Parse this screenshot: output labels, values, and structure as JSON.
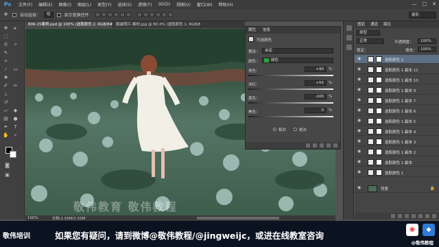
{
  "app": {
    "logo": "Ps"
  },
  "menu": [
    "文件(F)",
    "编辑(E)",
    "图像(I)",
    "图层(L)",
    "类型(Y)",
    "选择(S)",
    "滤镜(T)",
    "3D(D)",
    "视图(V)",
    "窗口(W)",
    "帮助(H)"
  ],
  "window_controls": [
    "—",
    "□",
    "✕"
  ],
  "options": {
    "auto_select_label": "自动选择：",
    "auto_select_value": "组",
    "show_transform_label": "显示变换控件",
    "workspace": "摄影"
  },
  "tabs": [
    {
      "label": "806-15案例.psd @ 100% (选取颜色 2, RGB/8#) *",
      "active": true
    },
    {
      "label": "服装照片-素材.jpg @ 80.4% (选取颜色 1, RGB/8#) *",
      "active": false
    }
  ],
  "status": {
    "zoom": "100%",
    "doc": "文档:1.55M/1.55M"
  },
  "watermark": "敬伟教育 敬伟教程",
  "properties": {
    "tabs": [
      "属性",
      "信息"
    ],
    "title": "可选颜色",
    "preset_label": "预设：",
    "preset_value": "自定",
    "colors_label": "颜色：",
    "colors_value": "绿色",
    "colors_swatch": "#2fa33a",
    "sliders": [
      {
        "label": "青色：",
        "value": "+90",
        "unit": "%"
      },
      {
        "label": "洋红：",
        "value": "+55",
        "unit": "%"
      },
      {
        "label": "黄色：",
        "value": "-100",
        "unit": "%"
      },
      {
        "label": "黑色：",
        "value": "0",
        "unit": "%"
      }
    ],
    "mode": [
      {
        "label": "相对",
        "selected": true
      },
      {
        "label": "绝对",
        "selected": false
      }
    ]
  },
  "layers": {
    "tabs": [
      "图层",
      "通道",
      "路径"
    ],
    "kind_label": "类型",
    "blend_mode": "正常",
    "opacity_label": "不透明度：",
    "opacity_value": "100%",
    "lock_label": "锁定：",
    "fill_label": "填充：",
    "fill_value": "100%",
    "items": [
      {
        "name": "选取颜色 2",
        "selected": true
      },
      {
        "name": "选取颜色 1 副本 11",
        "selected": false
      },
      {
        "name": "选取颜色 1 副本 10",
        "selected": false
      },
      {
        "name": "选取颜色 1 副本 9",
        "selected": false
      },
      {
        "name": "选取颜色 1 副本 7",
        "selected": false
      },
      {
        "name": "选取颜色 1 副本 6",
        "selected": false
      },
      {
        "name": "选取颜色 1 副本 5",
        "selected": false
      },
      {
        "name": "选取颜色 1 副本 4",
        "selected": false
      },
      {
        "name": "选取颜色 1 副本 3",
        "selected": false
      },
      {
        "name": "选取颜色 1 副本 2",
        "selected": false
      },
      {
        "name": "选取颜色 1 副本",
        "selected": false
      },
      {
        "name": "选取颜色 1",
        "selected": false
      }
    ],
    "background": "背景"
  },
  "banner": {
    "left": "敬伟培训",
    "text": "如果您有疑问，请到微博@敬伟教程/@jingweijc，或进在线教室咨询",
    "right": "@敬伟教程"
  }
}
